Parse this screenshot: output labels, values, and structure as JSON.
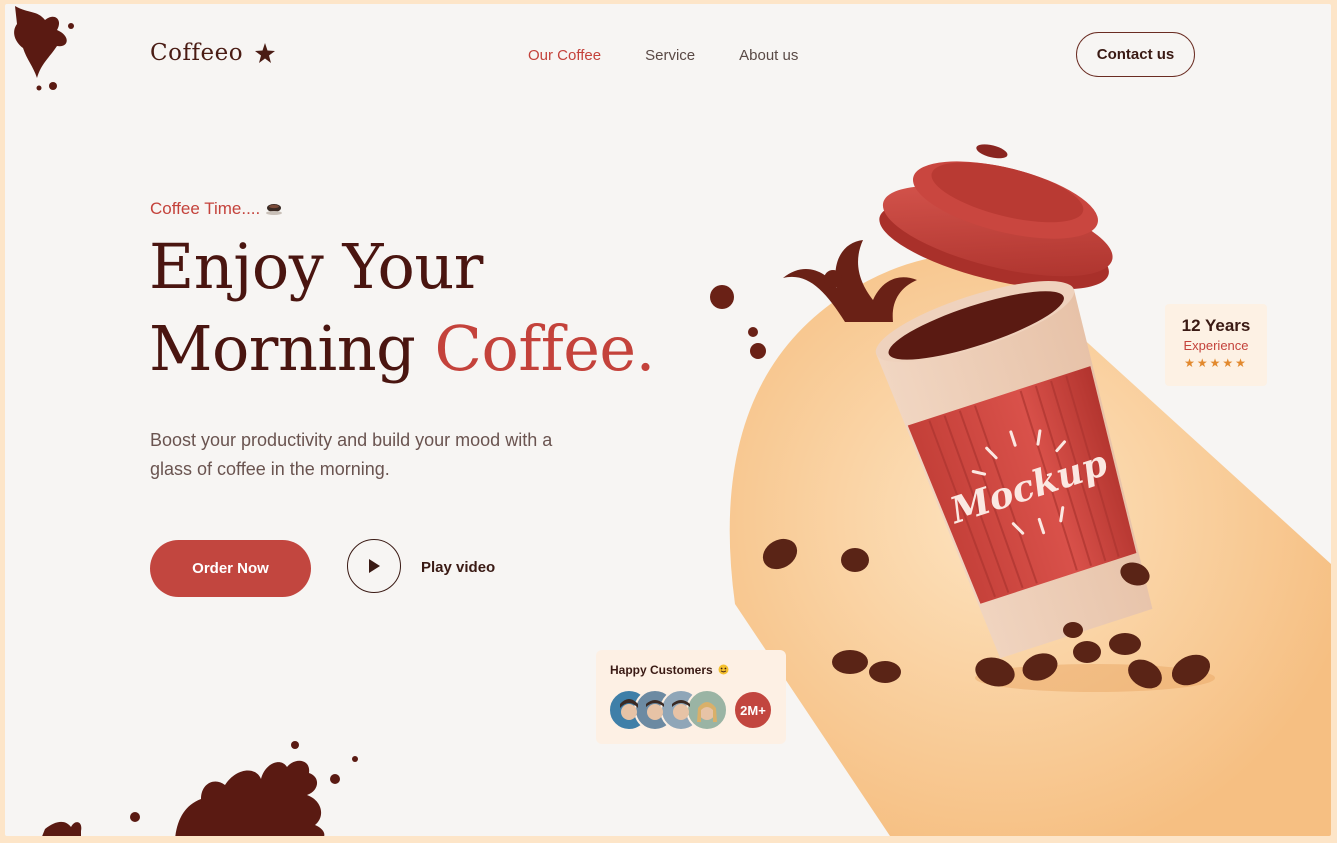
{
  "brand": {
    "name": "Coffeeo"
  },
  "nav": {
    "items": [
      "Our Coffee",
      "Service",
      "About us"
    ],
    "active": "Our Coffee"
  },
  "header": {
    "contact_label": "Contact us"
  },
  "hero": {
    "eyebrow": "Coffee Time....",
    "headline_line1": "Enjoy Your",
    "headline_line2_plain": "Morning ",
    "headline_line2_accent": "Coffee.",
    "subtitle": "Boost your productivity and build your mood with a glass of coffee in the morning.",
    "order_label": "Order Now",
    "play_label": "Play video"
  },
  "experience": {
    "years": "12 Years",
    "label": "Experience",
    "stars": "★★★★★",
    "rating": 5
  },
  "customers": {
    "title": "Happy Customers",
    "count": "2M+"
  },
  "cup": {
    "text": "Mockup"
  },
  "colors": {
    "accent": "#c4423b",
    "brown": "#4a1510",
    "peach": "#f7c98f",
    "background": "#f7f5f3"
  }
}
